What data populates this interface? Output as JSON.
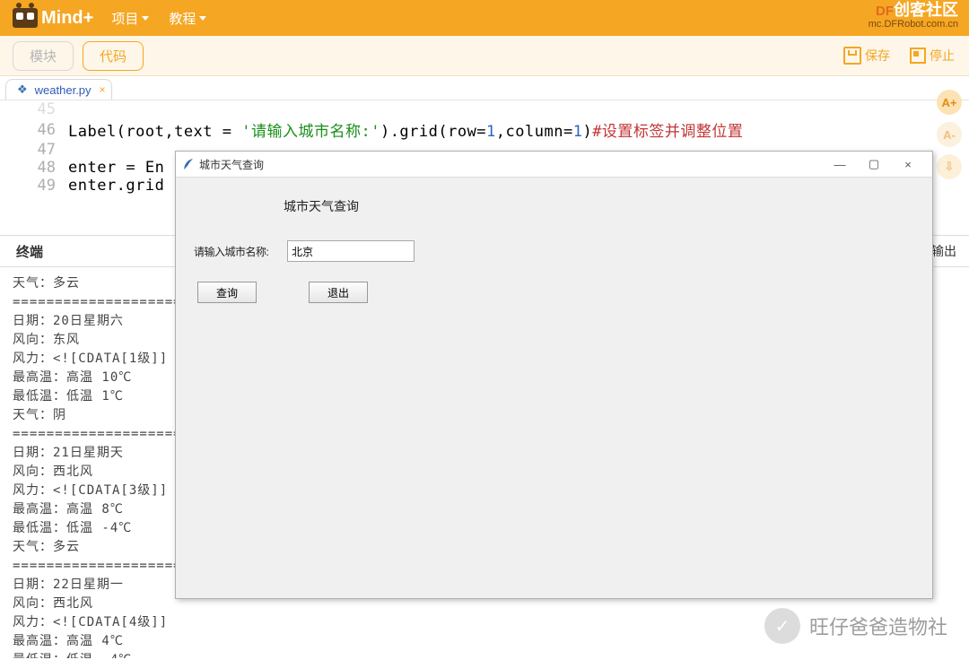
{
  "menubar": {
    "logo_text": "Mind+",
    "items": [
      "项目",
      "教程"
    ],
    "top_right_big": "创客社区",
    "top_right_df": "DF",
    "top_right_url": "mc.DFRobot.com.cn"
  },
  "toolbar": {
    "tab_module": "模块",
    "tab_code": "代码",
    "save": "保存",
    "stop": "停止",
    "zoom_plus": "A+",
    "zoom_minus": "A-"
  },
  "filetab": {
    "name": "weather.py",
    "close": "×",
    "icon": "❖"
  },
  "code": {
    "lines": [
      {
        "n": "45",
        "faded": true,
        "segs": []
      },
      {
        "n": "46",
        "segs": [
          {
            "t": "Label(root,text = "
          },
          {
            "t": "'请输入城市名称:'",
            "c": "tok-str"
          },
          {
            "t": ").grid(row="
          },
          {
            "t": "1",
            "c": "tok-num"
          },
          {
            "t": ",column="
          },
          {
            "t": "1",
            "c": "tok-num"
          },
          {
            "t": ")"
          },
          {
            "t": "#设置标签并调整位置",
            "c": "tok-comment"
          }
        ]
      },
      {
        "n": "47",
        "segs": []
      },
      {
        "n": "48",
        "segs": [
          {
            "t": "enter = En"
          }
        ]
      },
      {
        "n": "49",
        "segs": [
          {
            "t": "enter.grid"
          }
        ]
      }
    ]
  },
  "terminal": {
    "title": "终端",
    "output_tab": "输出",
    "text": "天气：多云\n==============================================\n日期：20日星期六\n风向：东风\n风力：<![CDATA[1级]]\n最高温：高温 10℃\n最低温：低温 1℃\n天气：阴\n==============================================\n日期：21日星期天\n风向：西北风\n风力：<![CDATA[3级]]\n最高温：高温 8℃\n最低温：低温 -4℃\n天气：多云\n==============================================\n日期：22日星期一\n风向：西北风\n风力：<![CDATA[4级]]\n最高温：高温 4℃\n最低温：低温 -4℃\n天气：晴\n北京今日感冒多发期，适当减少外出频率，适量补充水分，适当增减衣物。"
  },
  "tkwindow": {
    "title": "城市天气查询",
    "heading": "城市天气查询",
    "label_city": "请输入城市名称:",
    "entry_value": "北京",
    "btn_query": "查询",
    "btn_exit": "退出",
    "min": "—",
    "max": "▢",
    "close": "×"
  },
  "watermark": {
    "icon": "✓",
    "text": "旺仔爸爸造物社"
  }
}
